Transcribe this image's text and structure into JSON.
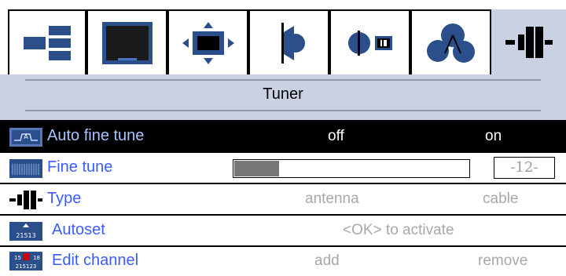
{
  "tabs": [
    {
      "icon": "picture-layout-icon",
      "active": false
    },
    {
      "icon": "screen-icon",
      "active": false
    },
    {
      "icon": "position-arrows-icon",
      "active": false
    },
    {
      "icon": "speaker-icon",
      "active": false
    },
    {
      "icon": "clock-timer-icon",
      "active": false
    },
    {
      "icon": "features-icon",
      "active": false
    },
    {
      "icon": "tuner-plug-icon",
      "active": true
    }
  ],
  "title": "Tuner",
  "rows": {
    "auto_fine_tune": {
      "label": "Auto fine tune",
      "off": "off",
      "on": "on",
      "selected": true
    },
    "fine_tune": {
      "label": "Fine tune",
      "value": "-12-",
      "level": 0.19
    },
    "type": {
      "label": "Type",
      "option1": "antenna",
      "option2": "cable"
    },
    "autoset": {
      "label": "Autoset",
      "action": "<OK> to activate"
    },
    "edit_channel": {
      "label": "Edit channel",
      "add": "add",
      "remove": "remove"
    }
  },
  "colors": {
    "accent": "#3c5cff",
    "band": "#c9d1e3",
    "selected_bg": "#000000",
    "inactive_text": "#a8a8a8"
  }
}
